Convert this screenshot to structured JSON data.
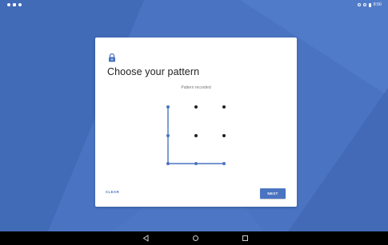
{
  "status_bar": {
    "time": "8:50"
  },
  "dialog": {
    "title": "Choose your pattern",
    "subtitle": "Pattern recorded",
    "clear_label": "CLEAR",
    "next_label": "NEXT"
  },
  "pattern": {
    "grid": "3x3",
    "selected_dots": [
      1,
      4,
      7,
      8,
      9
    ],
    "path_order": [
      1,
      4,
      7,
      8,
      9
    ]
  },
  "colors": {
    "accent": "#4a74c2",
    "background": "#4a74c2",
    "card": "#ffffff",
    "dot_idle": "#212121"
  },
  "navigation": {
    "back_icon": "back-triangle-icon",
    "home_icon": "home-circle-icon",
    "recents_icon": "recents-square-icon"
  }
}
